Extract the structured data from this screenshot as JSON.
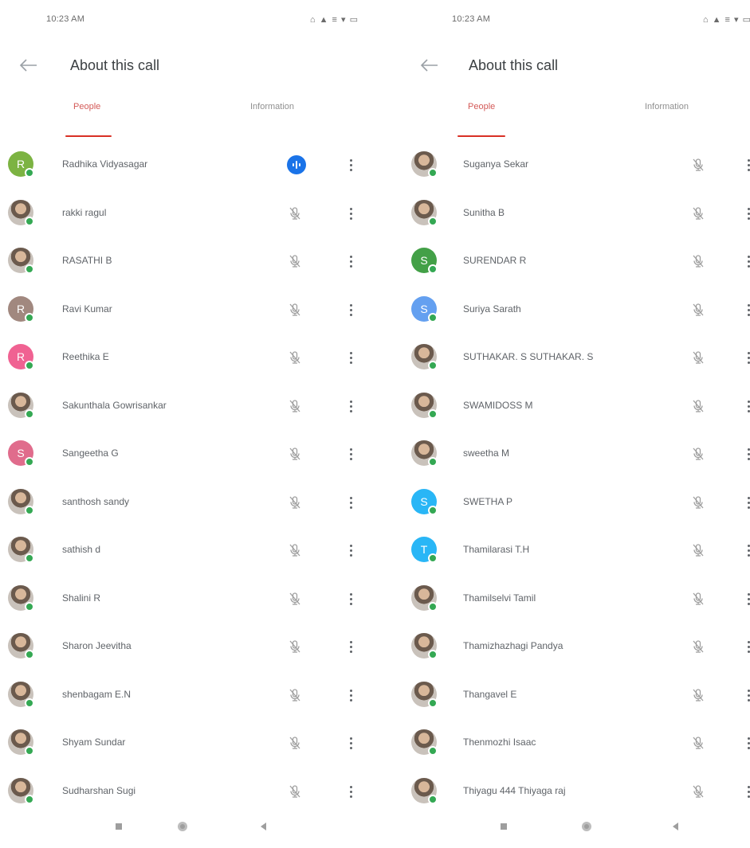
{
  "screens": [
    {
      "status": {
        "time": "10:23 AM",
        "icons": "⌂ ▲ ≡ ▾ ▭"
      },
      "title": "About this call",
      "tabs": [
        "People",
        "Information"
      ],
      "participants": [
        {
          "name": "Radhika Vidyasagar",
          "initial": "R",
          "color": "#7cb342",
          "photo": false,
          "speaking": true
        },
        {
          "name": "rakki ragul",
          "initial": "",
          "color": "",
          "photo": true,
          "speaking": false
        },
        {
          "name": "RASATHI B",
          "initial": "",
          "color": "",
          "photo": true,
          "speaking": false
        },
        {
          "name": "Ravi Kumar",
          "initial": "R",
          "color": "#a1887f",
          "photo": false,
          "speaking": false
        },
        {
          "name": "Reethika E",
          "initial": "R",
          "color": "#f06292",
          "photo": false,
          "speaking": false
        },
        {
          "name": "Sakunthala Gowrisankar",
          "initial": "",
          "color": "",
          "photo": true,
          "speaking": false
        },
        {
          "name": "Sangeetha G",
          "initial": "S",
          "color": "#e06c8c",
          "photo": false,
          "speaking": false
        },
        {
          "name": "santhosh sandy",
          "initial": "",
          "color": "",
          "photo": true,
          "speaking": false
        },
        {
          "name": "sathish d",
          "initial": "",
          "color": "",
          "photo": true,
          "speaking": false
        },
        {
          "name": "Shalini R",
          "initial": "",
          "color": "",
          "photo": true,
          "speaking": false
        },
        {
          "name": "Sharon Jeevitha",
          "initial": "",
          "color": "",
          "photo": true,
          "speaking": false
        },
        {
          "name": "shenbagam E.N",
          "initial": "",
          "color": "",
          "photo": true,
          "speaking": false
        },
        {
          "name": "Shyam Sundar",
          "initial": "",
          "color": "",
          "photo": true,
          "speaking": false
        },
        {
          "name": "Sudharshan Sugi",
          "initial": "",
          "color": "",
          "photo": true,
          "speaking": false
        }
      ]
    },
    {
      "status": {
        "time": "10:23 AM",
        "icons": "⌂ ▲ ≡ ▾ ▭"
      },
      "title": "About this call",
      "tabs": [
        "People",
        "Information"
      ],
      "participants": [
        {
          "name": "Suganya Sekar",
          "initial": "",
          "color": "",
          "photo": true,
          "speaking": false
        },
        {
          "name": "Sunitha B",
          "initial": "",
          "color": "",
          "photo": true,
          "speaking": false
        },
        {
          "name": "SURENDAR R",
          "initial": "S",
          "color": "#43a047",
          "photo": false,
          "speaking": false
        },
        {
          "name": "Suriya Sarath",
          "initial": "S",
          "color": "#64a0f0",
          "photo": false,
          "speaking": false
        },
        {
          "name": "SUTHAKAR. S SUTHAKAR. S",
          "initial": "",
          "color": "",
          "photo": true,
          "speaking": false
        },
        {
          "name": "SWAMIDOSS M",
          "initial": "",
          "color": "",
          "photo": true,
          "speaking": false
        },
        {
          "name": "sweetha M",
          "initial": "",
          "color": "",
          "photo": true,
          "speaking": false
        },
        {
          "name": "SWETHA P",
          "initial": "S",
          "color": "#29b6f6",
          "photo": false,
          "speaking": false
        },
        {
          "name": "Thamilarasi T.H",
          "initial": "T",
          "color": "#29b6f6",
          "photo": false,
          "speaking": false
        },
        {
          "name": "Thamilselvi Tamil",
          "initial": "",
          "color": "",
          "photo": true,
          "speaking": false
        },
        {
          "name": "Thamizhazhagi Pandya",
          "initial": "",
          "color": "",
          "photo": true,
          "speaking": false
        },
        {
          "name": "Thangavel E",
          "initial": "",
          "color": "",
          "photo": true,
          "speaking": false
        },
        {
          "name": "Thenmozhi Isaac",
          "initial": "",
          "color": "",
          "photo": true,
          "speaking": false
        },
        {
          "name": "Thiyagu 444 Thiyaga raj",
          "initial": "",
          "color": "",
          "photo": true,
          "speaking": false
        }
      ]
    }
  ]
}
